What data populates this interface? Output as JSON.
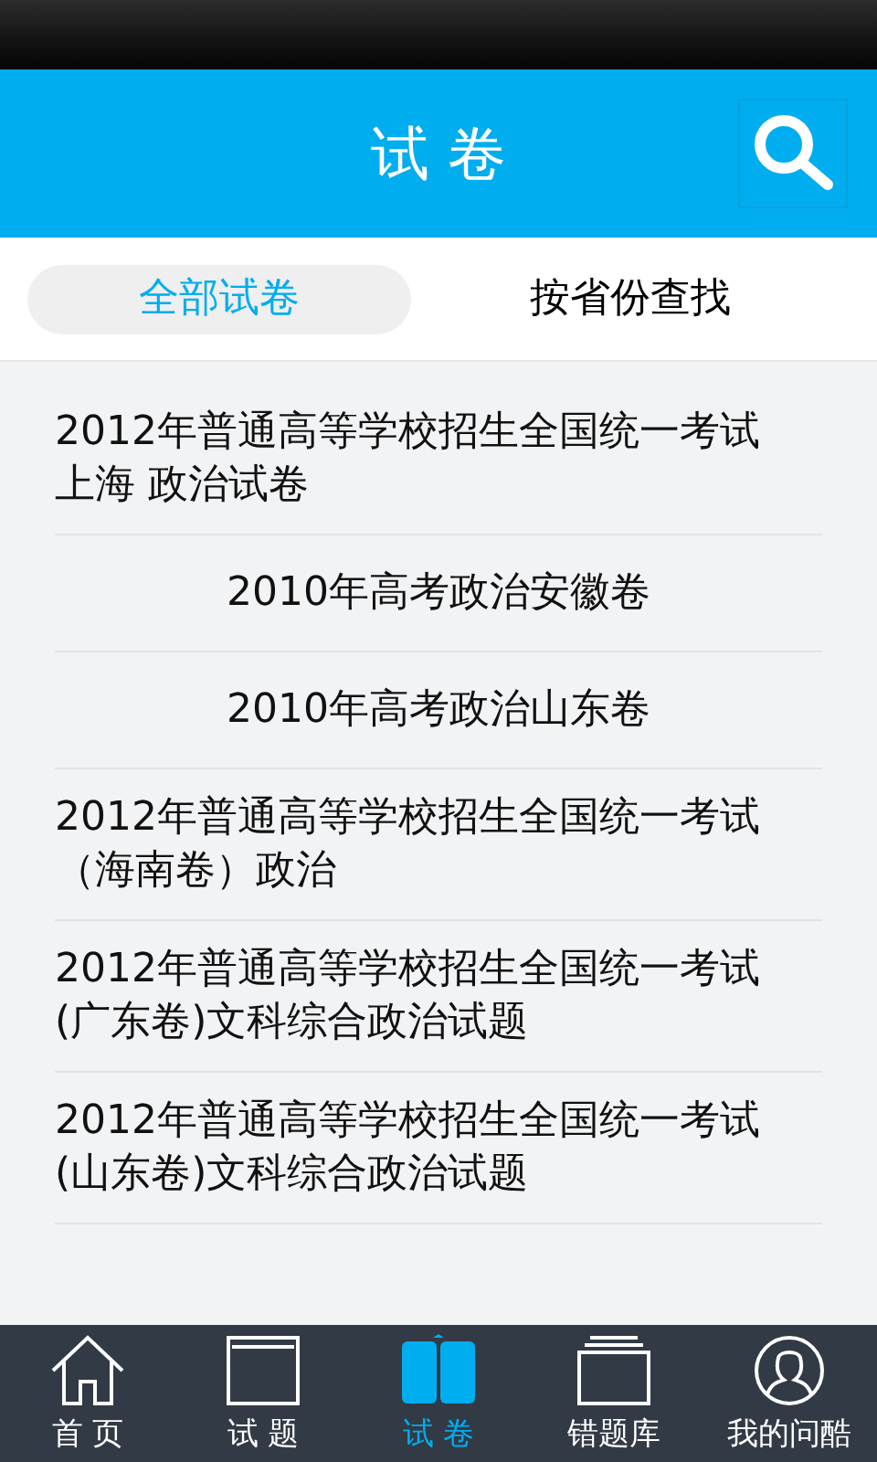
{
  "header": {
    "title": "试 卷"
  },
  "filter_tabs": [
    {
      "label": "全部试卷",
      "selected": true
    },
    {
      "label": "按省份查找",
      "selected": false
    }
  ],
  "papers": [
    {
      "title": "2012年普通高等学校招生全国统一考试上海 政治试卷",
      "kind": "plain"
    },
    {
      "title": "2010年高考政治安徽卷",
      "kind": "centered"
    },
    {
      "title": "2010年高考政治山东卷",
      "kind": "centered"
    },
    {
      "title": "2012年普通高等学校招生全国统一考试（海南卷）政治",
      "kind": "plain"
    },
    {
      "title": "2012年普通高等学校招生全国统一考试(广东卷)文科综合政治试题",
      "kind": "plain"
    },
    {
      "title": "2012年普通高等学校招生全国统一考试(山东卷)文科综合政治试题",
      "kind": "plain"
    }
  ],
  "bottom_nav": [
    {
      "label": "首 页",
      "kind": "home",
      "selected": false
    },
    {
      "label": "试 题",
      "kind": "window",
      "selected": false
    },
    {
      "label": "试 卷",
      "kind": "book",
      "selected": true
    },
    {
      "label": "错题库",
      "kind": "stack",
      "selected": false
    },
    {
      "label": "我的问酷",
      "kind": "person",
      "selected": false
    }
  ]
}
